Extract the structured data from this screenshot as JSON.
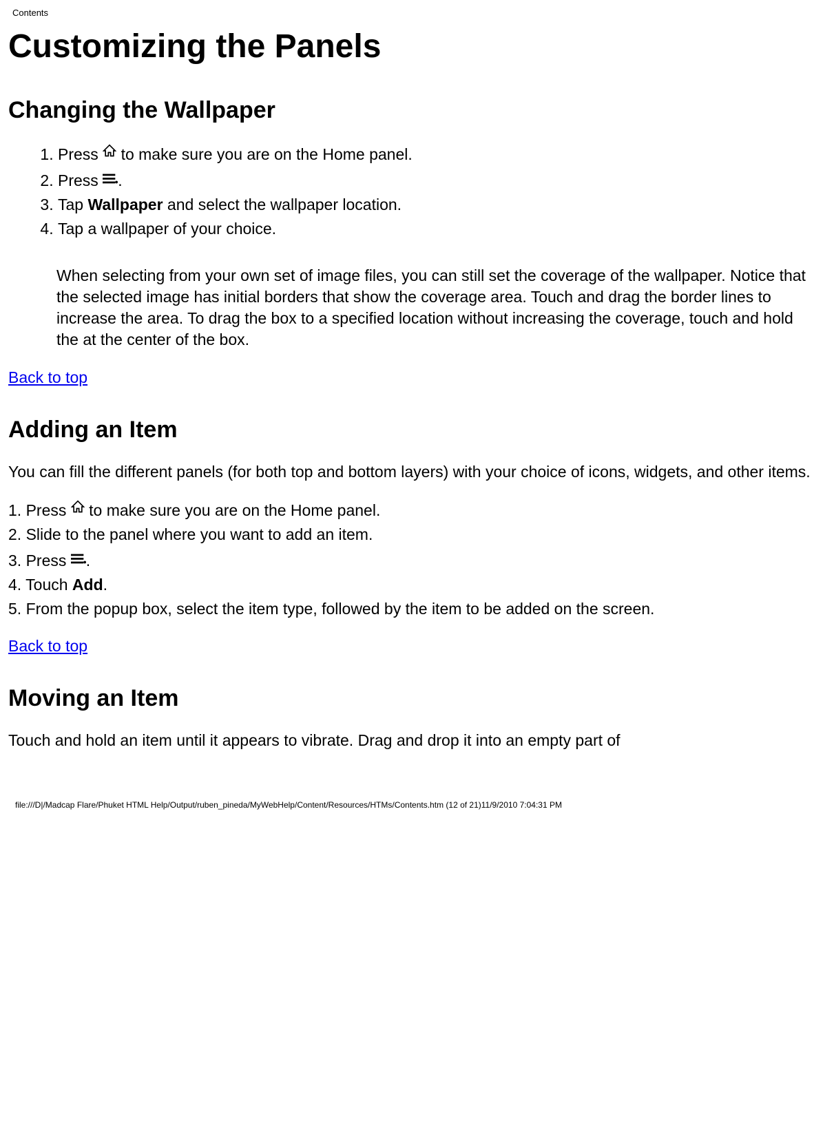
{
  "headerLabel": "Contents",
  "title": "Customizing the Panels",
  "section1": {
    "heading": "Changing the Wallpaper",
    "steps": {
      "s1a": "Press ",
      "s1b": " to make sure you are on the Home panel.",
      "s2a": "Press ",
      "s2b": ".",
      "s3a": "Tap ",
      "s3bold": "Wallpaper",
      "s3b": " and select the wallpaper location.",
      "s4": "Tap a wallpaper of your choice."
    },
    "note": "When selecting from your own set of image files, you can still set the coverage of the wallpaper. Notice that the selected image has initial borders that show the coverage area. Touch and drag the border lines to increase the area. To drag the box to a specified location without increasing the coverage, touch and hold the at the center of the box."
  },
  "backToTop": "Back to top",
  "section2": {
    "heading": "Adding an Item",
    "intro": "You can fill the different panels (for both top and bottom layers) with your choice of icons, widgets, and other items.",
    "steps": {
      "p1a": "1. Press ",
      "p1b": " to make sure you are on the Home panel.",
      "p2": "2. Slide to the panel where you want to add an item.",
      "p3a": "3. Press ",
      "p3b": ".",
      "p4a": "4. Touch ",
      "p4bold": "Add",
      "p4b": ".",
      "p5": "5. From the popup box, select the item type, followed by the item to be added on the screen."
    }
  },
  "section3": {
    "heading": "Moving an Item",
    "text": "Touch and hold an item until it appears to vibrate. Drag and drop it into an empty part of"
  },
  "footer": "file:///D|/Madcap Flare/Phuket HTML Help/Output/ruben_pineda/MyWebHelp/Content/Resources/HTMs/Contents.htm (12 of 21)11/9/2010 7:04:31 PM"
}
